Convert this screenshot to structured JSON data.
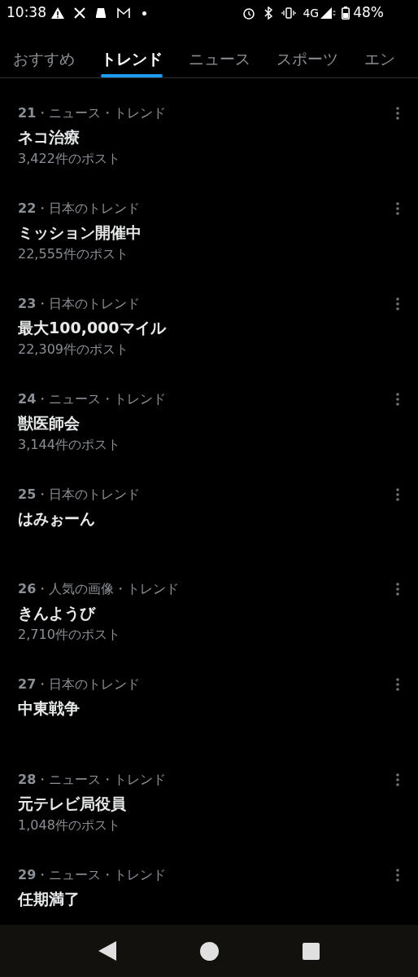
{
  "status_bar": {
    "time": "10:38",
    "network": "4G",
    "battery": "48%"
  },
  "tabs": [
    {
      "label": "おすすめ",
      "selected": false
    },
    {
      "label": "トレンド",
      "selected": true
    },
    {
      "label": "ニュース",
      "selected": false
    },
    {
      "label": "スポーツ",
      "selected": false
    },
    {
      "label": "エン",
      "selected": false
    }
  ],
  "trends": [
    {
      "context": "**21**・ニュース・トレンド",
      "title": "ネコ治療",
      "posts": "3,422件のポスト"
    },
    {
      "context": "**22**・日本のトレンド",
      "title": "ミッション開催中",
      "posts": "22,555件のポスト"
    },
    {
      "context": "**23**・日本のトレンド",
      "title": "最大100,000マイル",
      "posts": "22,309件のポスト"
    },
    {
      "context": "**24**・ニュース・トレンド",
      "title": "獣医師会",
      "posts": "3,144件のポスト"
    },
    {
      "context": "**25**・日本のトレンド",
      "title": "はみぉーん"
    },
    {
      "context": "**26**・人気の画像・トレンド",
      "title": "きんようび",
      "posts": "2,710件のポスト"
    },
    {
      "context": "**27**・日本のトレンド",
      "title": "中東戦争"
    },
    {
      "context": "**28**・ニュース・トレンド",
      "title": "元テレビ局役員",
      "posts": "1,048件のポスト"
    },
    {
      "context": "**29**・ニュース・トレンド",
      "title": "任期満了"
    }
  ]
}
